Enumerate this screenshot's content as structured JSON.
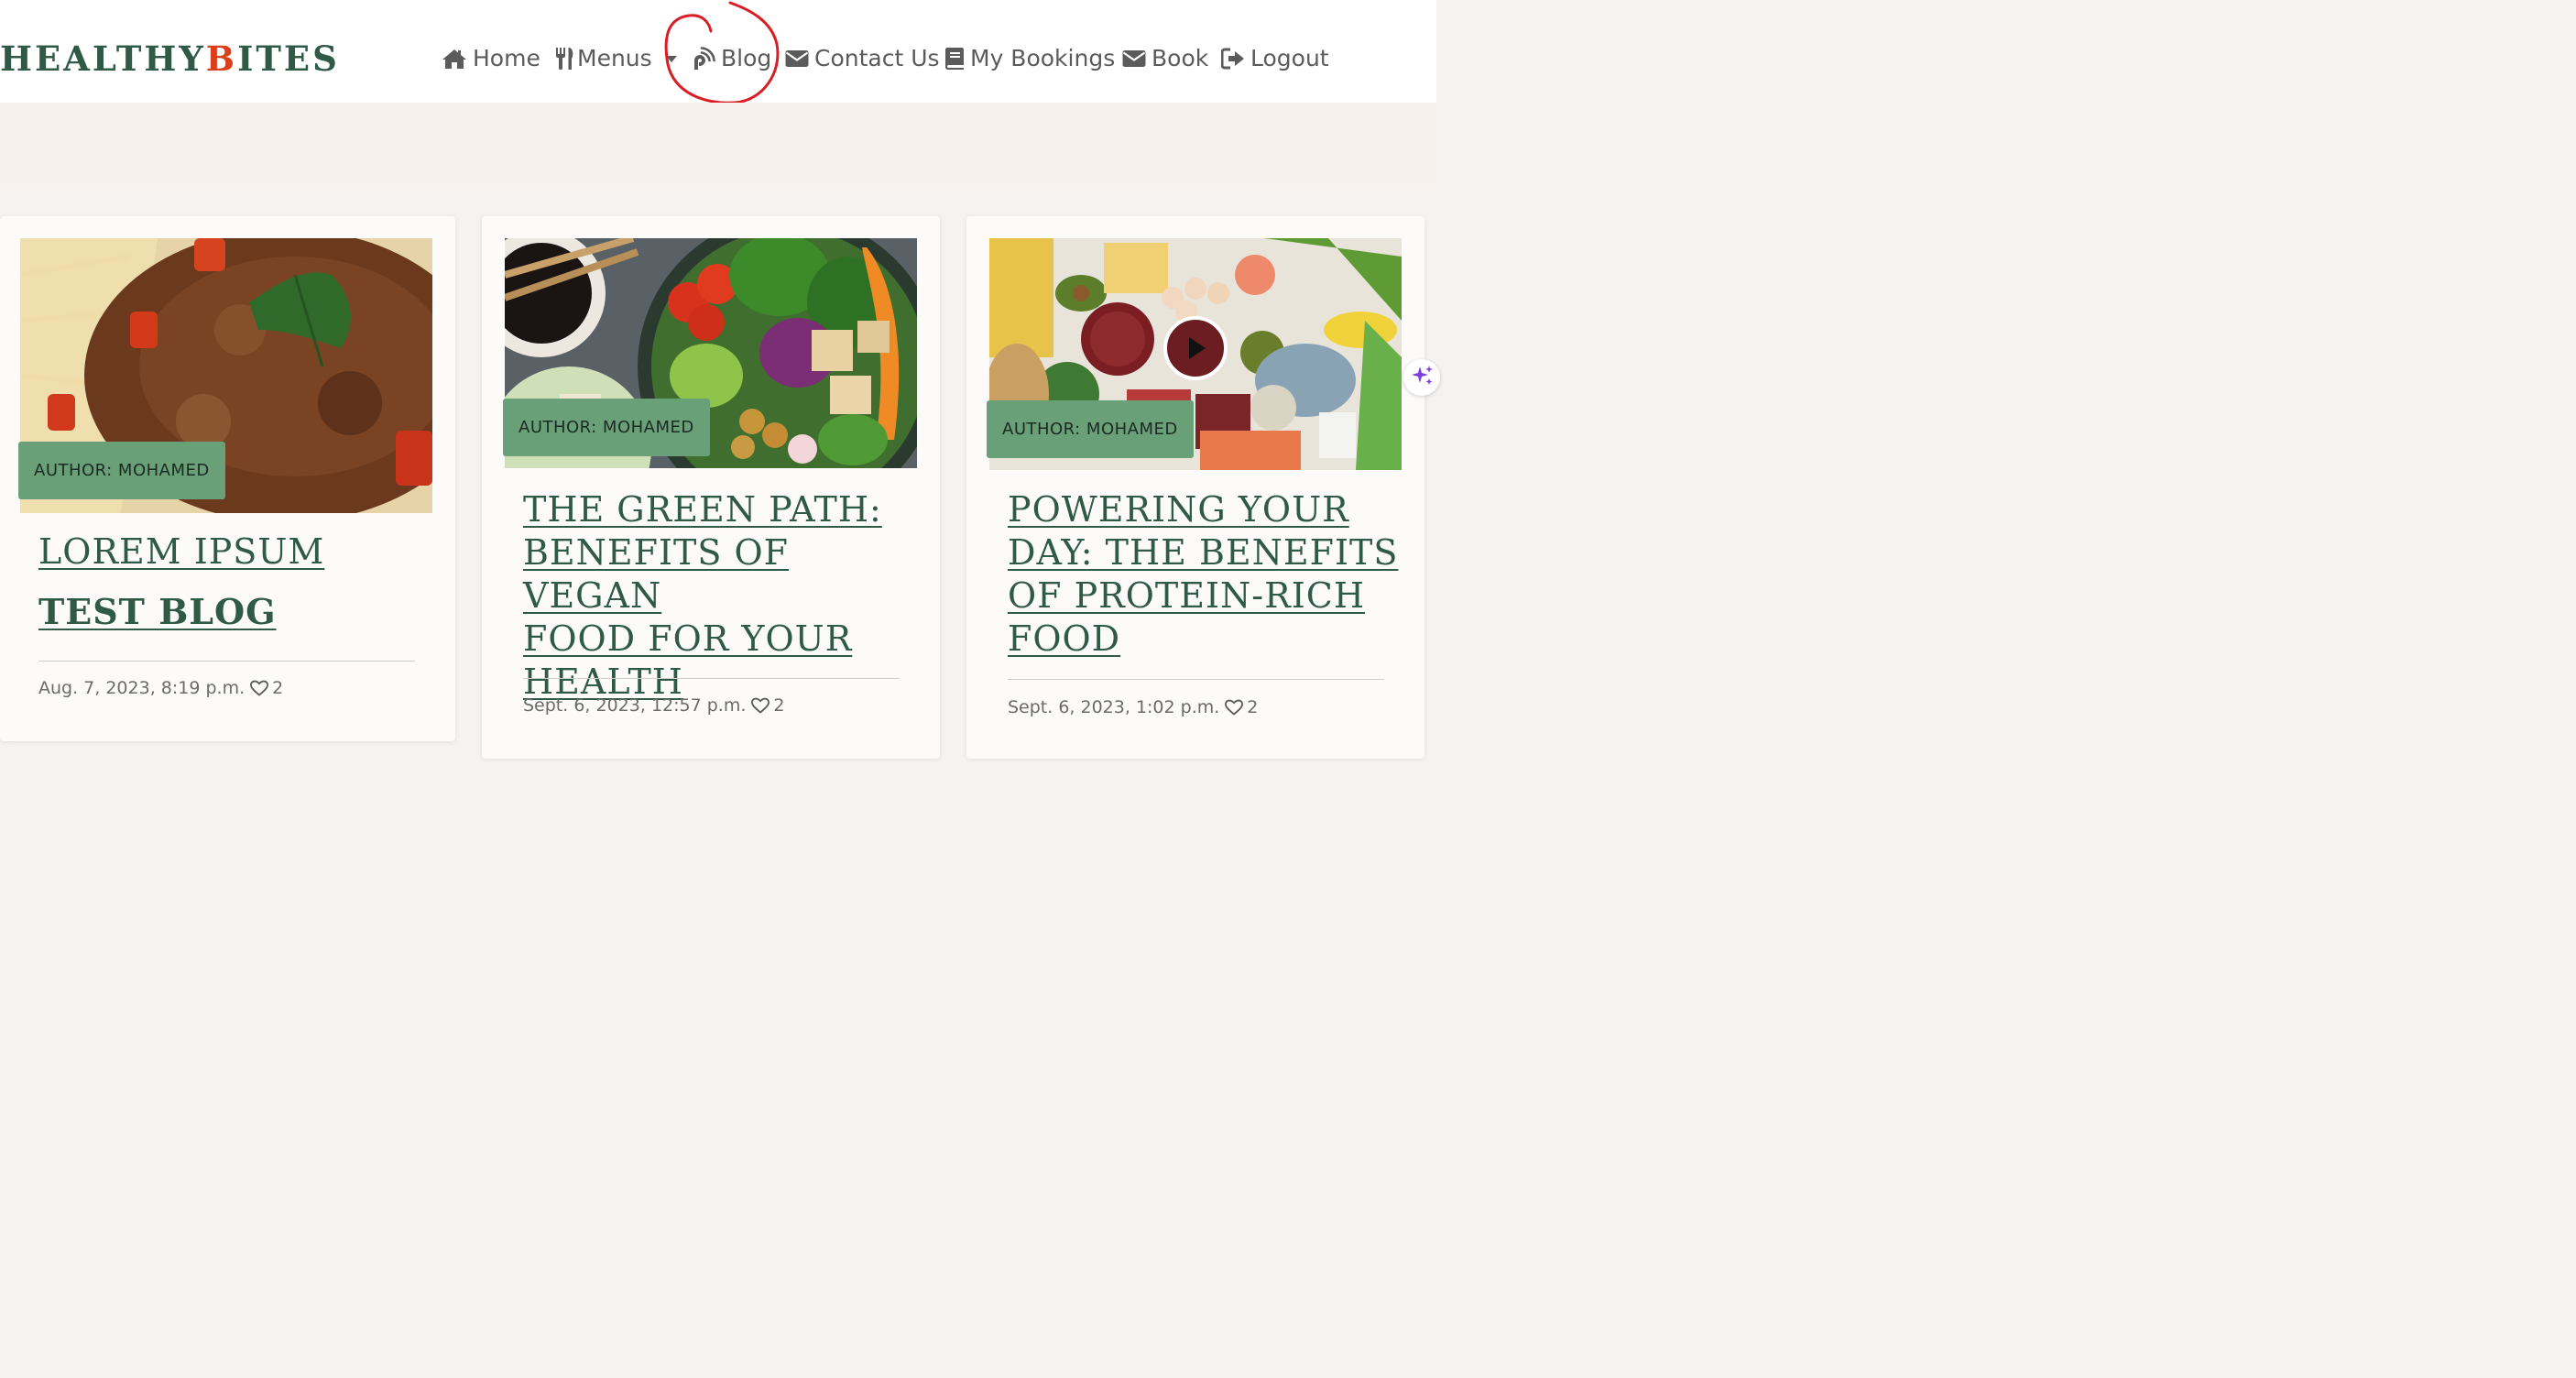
{
  "brand": {
    "part1": "HEALTHY",
    "part2": "B",
    "part3": "ITES"
  },
  "nav": {
    "home": "Home",
    "menus": "Menus",
    "blog": "Blog",
    "contact": "Contact Us",
    "bookings": "My Bookings",
    "book": "Book",
    "logout": "Logout"
  },
  "posts": [
    {
      "author": "AUTHOR: MOHAMED",
      "title_line1": "LOREM IPSUM",
      "title_line2": "TEST BLOG",
      "date": "Aug. 7, 2023, 8:19 p.m.",
      "likes": "2",
      "image": "pasta-bolognese-photo"
    },
    {
      "author": "AUTHOR: MOHAMED",
      "title_line1": "THE GREEN PATH:",
      "title_line2": "BENEFITS OF VEGAN",
      "title_line3": "FOOD FOR YOUR",
      "title_line4": "HEALTH",
      "date": "Sept. 6, 2023, 12:57 p.m.",
      "likes": "2",
      "image": "vegan-bowl-photo"
    },
    {
      "author": "AUTHOR: MOHAMED",
      "title_line1": "POWERING YOUR",
      "title_line2": "DAY: THE BENEFITS",
      "title_line3": "OF PROTEIN-RICH",
      "title_line4": "FOOD",
      "date": "Sept. 6, 2023, 1:02 p.m.",
      "likes": "2",
      "image": "protein-foods-photo"
    }
  ],
  "colors": {
    "brand_green": "#2f5a45",
    "brand_orange": "#d9401a",
    "badge_green": "#6aa078",
    "annotation_red": "#d81f26"
  }
}
